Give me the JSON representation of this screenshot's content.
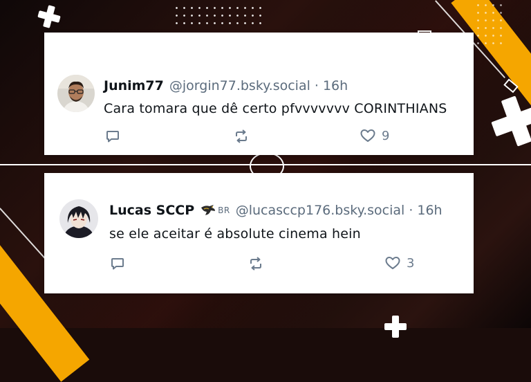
{
  "posts": [
    {
      "author_name": "Junim77",
      "handle": "@jorgin77.bsky.social",
      "separator": "·",
      "time": "16h",
      "text": "Cara tomara que dê certo pfvvvvvvv CORINTHIANS",
      "likes": "9",
      "avatar_icon": "profile-photo-man-with-glasses"
    },
    {
      "author_name": "Lucas SCCP",
      "badge_icon": "eagle-icon",
      "badge_text": "BR",
      "handle": "@lucasccp176.bsky.social",
      "separator": "·",
      "time": "16h",
      "text": "se ele aceitar é absolute cinema hein",
      "likes": "3",
      "avatar_icon": "profile-photo-anime-character"
    }
  ],
  "colors": {
    "accent_stripe": "#f5a600",
    "background": "#1a0c0a",
    "card": "#ffffff",
    "icon_gray": "#6b7b8d"
  }
}
